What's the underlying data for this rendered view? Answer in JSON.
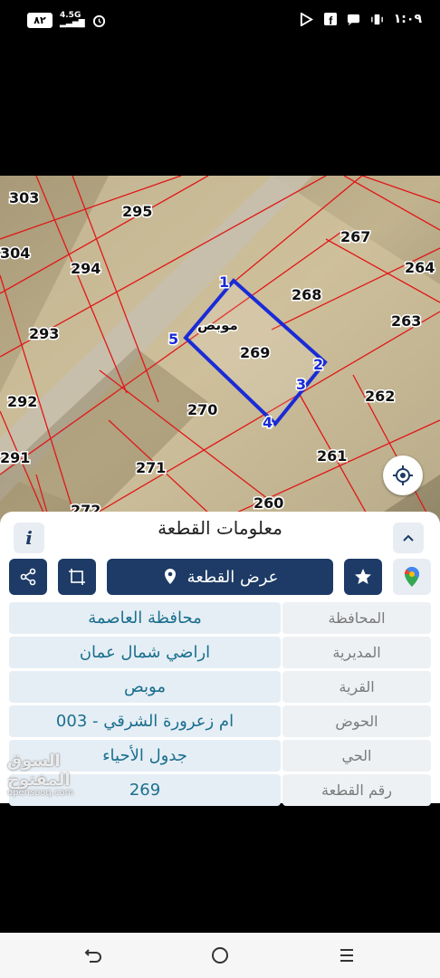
{
  "status_bar": {
    "battery": "٨٢",
    "network": "4.5G",
    "time": "١:٠٩"
  },
  "map": {
    "parcel_numbers": [
      "303",
      "295",
      "267",
      "304",
      "294",
      "264",
      "268",
      "293",
      "263",
      "269",
      "292",
      "262",
      "270",
      "291",
      "261",
      "271",
      "260",
      "272"
    ],
    "parcel_label": "موبص",
    "vertex_labels": [
      "1",
      "2",
      "3",
      "4",
      "5"
    ]
  },
  "panel": {
    "title": "معلومات القطعة",
    "info_label": "i",
    "show_parcel_label": "عرض القطعة",
    "rows": [
      {
        "key": "المحافظة",
        "value": "محافظة العاصمة"
      },
      {
        "key": "المديرية",
        "value": "اراضي شمال عمان"
      },
      {
        "key": "القرية",
        "value": "موبص"
      },
      {
        "key": "الحوض",
        "value": "ام زعرورة الشرقي - 003"
      },
      {
        "key": "الحي",
        "value": "جدول الأحياء"
      },
      {
        "key": "رقم القطعة",
        "value": "269"
      }
    ]
  },
  "watermark": {
    "arabic": "السوق المفتوح",
    "latin": "opensooq.com"
  },
  "colors": {
    "primary": "#1d3b66",
    "value_text": "#1a6f8e",
    "parcel_outline": "#1a2bd6",
    "grid_lines": "#e01818"
  },
  "icons": [
    "share-icon",
    "crop-icon",
    "location-pin-icon",
    "star-icon",
    "google-maps-icon",
    "target-icon",
    "back-icon",
    "home-icon",
    "recents-icon"
  ]
}
